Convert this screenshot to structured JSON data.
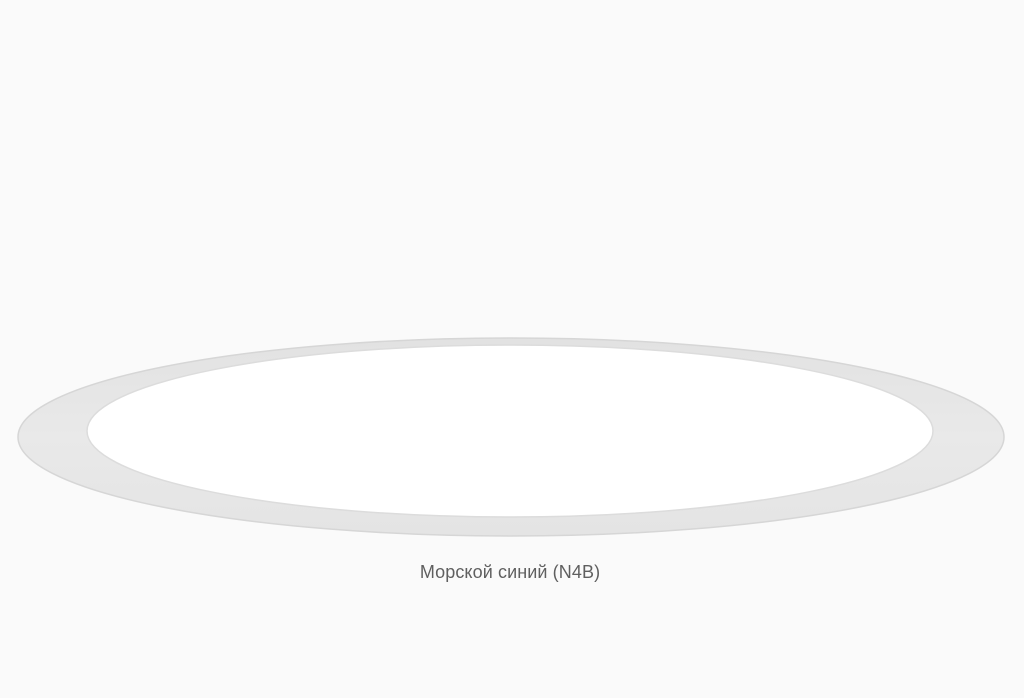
{
  "viewer": {
    "color_caption": "Морской синий (N4B)"
  },
  "colors": {
    "background": "#fafafa",
    "platform_ring": "#e8e8e8",
    "platform_surface": "#ffffff",
    "caption_text": "#5f5f5f"
  }
}
